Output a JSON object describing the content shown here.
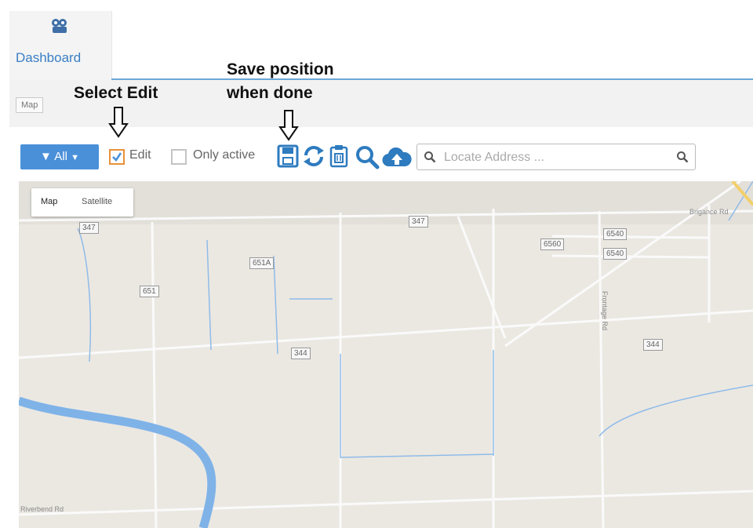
{
  "tab": {
    "label": "Dashboard"
  },
  "breadcrumb": {
    "label": "Map"
  },
  "annotations": {
    "select_edit": "Select Edit",
    "save_line1": "Save position",
    "save_line2": "when done"
  },
  "toolbar": {
    "filter_label": "All",
    "edit_label": "Edit",
    "edit_checked": true,
    "only_active_label": "Only active",
    "only_active_checked": false,
    "search_placeholder": "Locate Address ..."
  },
  "map": {
    "type_map": "Map",
    "type_satellite": "Satellite",
    "shields": [
      "347",
      "347",
      "651A",
      "651",
      "344",
      "6560",
      "6540",
      "6540",
      "344"
    ],
    "roads": [
      "Brigance Rd",
      "Riverbend Rd",
      "Frontage Rd"
    ]
  },
  "colors": {
    "accent": "#4a90d9",
    "check": "#e8913a",
    "water": "#7fb3e8"
  }
}
